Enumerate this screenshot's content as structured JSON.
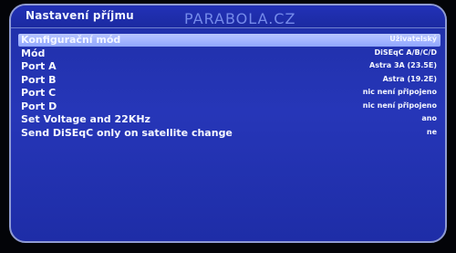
{
  "header": {
    "title": "Nastavení příjmu",
    "watermark": "PARABOLA.CZ"
  },
  "menu": {
    "items": [
      {
        "label": "Konfigurační mód",
        "value": "Uživatelský"
      },
      {
        "label": "Mód",
        "value": "DiSEqC A/B/C/D"
      },
      {
        "label": "Port A",
        "value": "Astra 3A (23.5E)"
      },
      {
        "label": "Port B",
        "value": "Astra (19.2E)"
      },
      {
        "label": "Port C",
        "value": "nic není připojeno"
      },
      {
        "label": "Port D",
        "value": "nic není připojeno"
      },
      {
        "label": "Set Voltage and 22KHz",
        "value": "ano"
      },
      {
        "label": "Send DiSEqC only on satellite change",
        "value": "ne"
      }
    ]
  },
  "colors": {
    "panel": "#2636b8",
    "selection": "#a9b8ff",
    "text": "#f5f7ff"
  }
}
